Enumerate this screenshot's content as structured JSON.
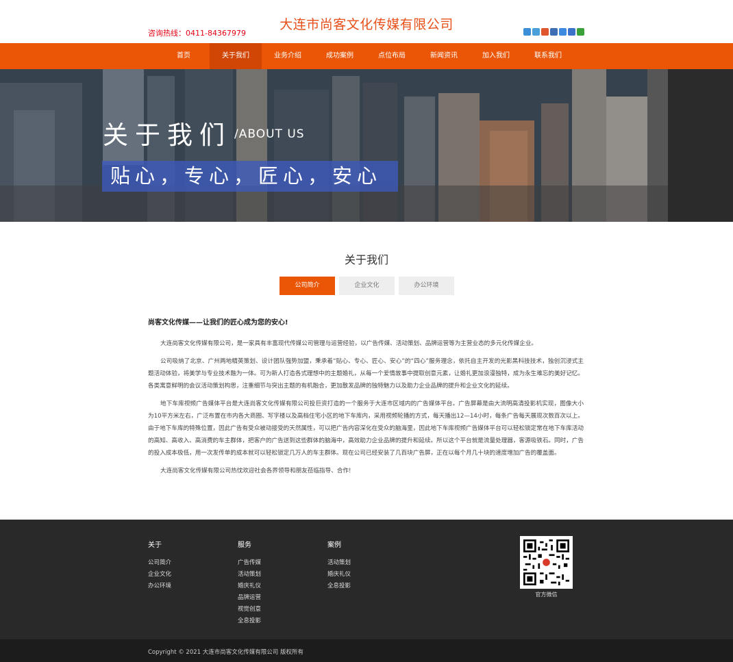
{
  "header": {
    "hotline": "咨询热线：0411-84367979",
    "company": "大连市尚客文化传媒有限公司",
    "share_colors": [
      "#3b8fd6",
      "#4aa0d8",
      "#e0562e",
      "#3e6fb5",
      "#3d8be0",
      "#3a73c9",
      "#3aa13a"
    ]
  },
  "nav": {
    "items": [
      "首页",
      "关于我们",
      "业务介绍",
      "成功案例",
      "点位布局",
      "新闻资讯",
      "加入我们",
      "联系我们"
    ],
    "active_index": 1
  },
  "banner": {
    "title": "关于我们",
    "subtitle": "/ABOUT US",
    "slogan": "贴心，专心，匠心，安心"
  },
  "about": {
    "section_title": "关于我们",
    "tabs": [
      "公司简介",
      "企业文化",
      "办公环境"
    ],
    "active_tab": 0,
    "heading": "尚客文化传媒——让我们的匠心成为您的安心!",
    "paragraphs": [
      "大连尚客文化传媒有限公司，是一家具有丰富现代传媒公司管理与运营经验，以广告传媒、活动策划、品牌运营等为主营业态的多元化传媒企业。",
      "公司吸纳了北京、广州两地精英策划、设计团队强势加盟，秉承着“贴心、专心、匠心、安心”的“四心”服务理念，依托自主开发的光影黑科技技术，独创沉浸式主题活动体验，将美学与专业技术融为一体。可为新人打造各式理想中的主题婚礼，从每一个爱情故事中提取创意元素，让婚礼更加浪漫独特，成为永生难忘的美好记忆。各类寓意鲜明的会议活动策划构思，注重细节与突出主题的有机融合，更加散发品牌的独特魅力以及助力企业品牌的提升和企业文化的延续。",
      "地下车库视频广告媒体平台是大连尚客文化传媒有限公司投巨资打造的一个服务于大连市区域内的广告媒体平台。广告屏幕是由大流明高清投影机实现，图像大小为10平方米左右，广泛布置在市内各大商圈、写字楼以及高档住宅小区的地下车库内，采用视频轮播的方式，每天播出12—14小时，每条广告每天展现次数百次以上。由于地下车库的特殊位置，因此广告有受众被动接受的天然属性，可以把广告内容深化在受众的脑海里，因此地下车库视频广告媒体平台可以轻松锁定常在地下车库活动的高知、高收入、高消费的车主群体，把客户的广告送到这些群体的脑海中，高效助力企业品牌的提升和延续。所以这个平台就是流量处理器，客源吸铁石。同时，广告的投入成本极低，用一次发传单的成本就可以轻松锁定几万人的车主群体。现在公司已经安装了几百块广告屏，正在以每个月几十块的速度增加广告的覆盖面。",
      "大连尚客文化传媒有限公司热忱欢迎社会各界领导和朋友莅临指导、合作!"
    ]
  },
  "footer": {
    "columns": [
      {
        "title": "关于",
        "links": [
          "公司简介",
          "企业文化",
          "办公环境"
        ]
      },
      {
        "title": "服务",
        "links": [
          "广告传媒",
          "活动策划",
          "婚庆礼仪",
          "品牌运营",
          "视觉创意",
          "全息投影"
        ]
      },
      {
        "title": "案例",
        "links": [
          "活动策划",
          "婚庆礼仪",
          "全息投影"
        ]
      }
    ],
    "qr_label": "官方微信",
    "copyright": "Copyright © 2021 大连市尚客文化传媒有限公司 版权所有"
  },
  "colors": {
    "accent": "#ea5506",
    "footer_bg": "#292929",
    "slogan_bg": "#3c5abe"
  }
}
